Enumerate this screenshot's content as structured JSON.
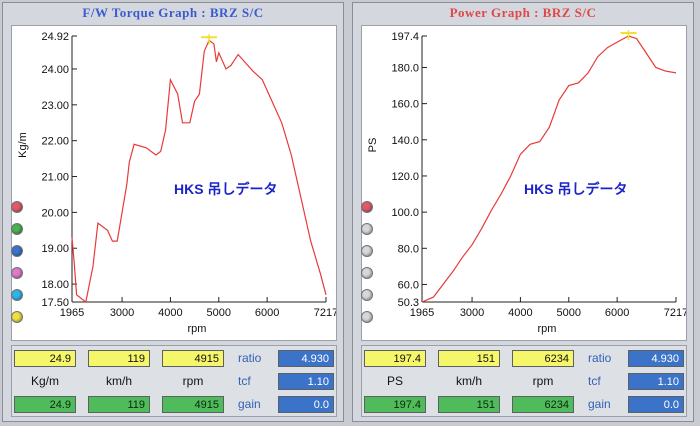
{
  "torque_panel": {
    "title": "F/W Torque Graph : BRZ S/C",
    "title_color": "#3a5bd0",
    "annotation": "HKS 吊しデータ",
    "readings_top": [
      "24.9",
      "119",
      "4915"
    ],
    "units": [
      "Kg/m",
      "km/h",
      "rpm"
    ],
    "readings_bottom": [
      "24.9",
      "119",
      "4915"
    ],
    "params": [
      {
        "label": "ratio",
        "value": "4.930"
      },
      {
        "label": "tcf",
        "value": "1.10"
      },
      {
        "label": "gain",
        "value": "0.0"
      }
    ],
    "indicator_colors": [
      "#e05a6a",
      "#4caf50",
      "#3b73c8",
      "#e07ac8",
      "#32b4e8",
      "#f0e040"
    ]
  },
  "power_panel": {
    "title": "Power Graph : BRZ S/C",
    "title_color": "#e04848",
    "annotation": "HKS 吊しデータ",
    "readings_top": [
      "197.4",
      "151",
      "6234"
    ],
    "units": [
      "PS",
      "km/h",
      "rpm"
    ],
    "readings_bottom": [
      "197.4",
      "151",
      "6234"
    ],
    "params": [
      {
        "label": "ratio",
        "value": "4.930"
      },
      {
        "label": "tcf",
        "value": "1.10"
      },
      {
        "label": "gain",
        "value": "0.0"
      }
    ],
    "indicator_colors": [
      "#e05a6a",
      "#d8d8d8",
      "#d8d8d8",
      "#d8d8d8",
      "#d8d8d8",
      "#d8d8d8"
    ]
  },
  "chart_data": [
    {
      "type": "line",
      "title": "F/W Torque Graph : BRZ S/C",
      "xlabel": "rpm",
      "ylabel": "Kg/m",
      "xlim": [
        1965,
        7217
      ],
      "ylim": [
        17.5,
        24.92
      ],
      "x_ticks": [
        1965,
        3000,
        4000,
        5000,
        6000,
        7217
      ],
      "x_tick_labels": [
        "1965",
        "3000",
        "4000",
        "5000",
        "6000",
        "7217"
      ],
      "y_ticks": [
        17.5,
        18.0,
        19.0,
        20.0,
        21.0,
        22.0,
        23.0,
        24.0,
        24.92
      ],
      "y_tick_labels": [
        "17.50",
        "18.00",
        "19.00",
        "20.00",
        "21.00",
        "22.00",
        "23.00",
        "24.00",
        "24.92"
      ],
      "grid": false,
      "line_color": "#e83a3a",
      "peak_marker_color": "#f0e030",
      "series": [
        {
          "x": [
            1965,
            2010,
            2060,
            2250,
            2400,
            2500,
            2700,
            2800,
            2900,
            3000,
            3100,
            3150,
            3250,
            3500,
            3700,
            3800,
            3900,
            4000,
            4150,
            4250,
            4400,
            4500,
            4600,
            4700,
            4800,
            4900,
            4950,
            5000,
            5150,
            5250,
            5400,
            5500,
            5700,
            5900,
            6100,
            6300,
            6500,
            6700,
            6900,
            7100,
            7217
          ],
          "y": [
            19.3,
            18.6,
            17.7,
            17.5,
            18.5,
            19.7,
            19.5,
            19.2,
            19.2,
            20.0,
            20.8,
            21.4,
            21.9,
            21.8,
            21.6,
            21.7,
            22.3,
            23.7,
            23.3,
            22.5,
            22.5,
            23.1,
            23.3,
            24.5,
            24.8,
            24.7,
            24.2,
            24.45,
            24.0,
            24.1,
            24.4,
            24.25,
            23.95,
            23.7,
            23.1,
            22.5,
            21.6,
            20.4,
            19.2,
            18.3,
            17.7
          ]
        }
      ]
    },
    {
      "type": "line",
      "title": "Power Graph : BRZ S/C",
      "xlabel": "rpm",
      "ylabel": "PS",
      "xlim": [
        1965,
        7217
      ],
      "ylim": [
        50.3,
        197.4
      ],
      "x_ticks": [
        1965,
        3000,
        4000,
        5000,
        6000,
        7217
      ],
      "x_tick_labels": [
        "1965",
        "3000",
        "4000",
        "5000",
        "6000",
        "7217"
      ],
      "y_ticks": [
        50.3,
        60.0,
        80.0,
        100.0,
        120.0,
        140.0,
        160.0,
        180.0,
        197.4
      ],
      "y_tick_labels": [
        "50.3",
        "60.0",
        "80.0",
        "100.0",
        "120.0",
        "140.0",
        "160.0",
        "180.0",
        "197.4"
      ],
      "grid": false,
      "line_color": "#e83a3a",
      "peak_marker_color": "#f0e030",
      "series": [
        {
          "x": [
            1965,
            2200,
            2400,
            2600,
            2800,
            3000,
            3200,
            3400,
            3600,
            3800,
            4000,
            4200,
            4400,
            4600,
            4800,
            5000,
            5200,
            5400,
            5600,
            5800,
            6000,
            6234,
            6400,
            6600,
            6800,
            7000,
            7217
          ],
          "y": [
            50.3,
            53.0,
            60.0,
            67.0,
            75.0,
            82.0,
            91.0,
            101.0,
            110.0,
            120.0,
            132.0,
            137.5,
            139.0,
            147.0,
            162.0,
            170.0,
            171.5,
            177.0,
            186.0,
            191.0,
            194.0,
            197.4,
            196.0,
            188.0,
            180.0,
            178.0,
            177.0
          ]
        }
      ]
    }
  ]
}
